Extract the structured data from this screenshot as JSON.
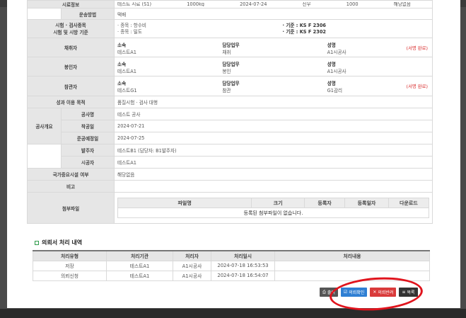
{
  "form": {
    "row_top": {
      "label": "시료정보",
      "value": "테스트 시료 (S1)",
      "qty": "1000kg",
      "date": "2024-07-24",
      "status": "진우",
      "num": "1000",
      "result": "해당없음"
    },
    "transport": {
      "label": "운송방법",
      "value": "택배"
    },
    "test": {
      "label": "시험 · 검사종목\n시험 및 시방 기준",
      "line1_type": "· 종목 : 항수비",
      "line1_std": "· 기준 : KS F 2306",
      "line2_type": "· 종목 : 밀도",
      "line2_std": "· 기준 : KS F 2302"
    },
    "sampler": {
      "label": "채취자",
      "org_k": "소속",
      "org": "테스트A1",
      "task_k": "담당업무",
      "task": "채취",
      "name_k": "성명",
      "name": "A1시공사",
      "sign": "(서명 완료)"
    },
    "sealer": {
      "label": "봉인자",
      "org_k": "소속",
      "org": "테스트A1",
      "task_k": "담당업무",
      "task": "봉인",
      "name_k": "성명",
      "name": "A1시공사",
      "sign": ""
    },
    "witness": {
      "label": "참관자",
      "org_k": "소속",
      "org": "테스트G1",
      "task_k": "담당업무",
      "task": "참관",
      "name_k": "성명",
      "name": "G1감리",
      "sign": "(서명 완료)"
    },
    "purpose": {
      "label": "성과 이용 목적",
      "value": "품질시험 · 검사 대행"
    },
    "overview_label": "공사개요",
    "project": {
      "label": "공사명",
      "value": "테스트 공사"
    },
    "start": {
      "label": "착공일",
      "value": "2024-07-21"
    },
    "finish": {
      "label": "준공예정일",
      "value": "2024-07-25"
    },
    "client": {
      "label": "발주자",
      "value": "테스트B1 (담당자: B1발주자)"
    },
    "builder": {
      "label": "시공자",
      "value": "테스트A1"
    },
    "national": {
      "label": "국가중요시설 여부",
      "value": "해당없음"
    },
    "remark": {
      "label": "비고",
      "value": ""
    },
    "attach": {
      "label": "첨부파일",
      "cols": [
        "파일명",
        "크기",
        "등록자",
        "등록일자",
        "다운로드"
      ],
      "empty": "등록된 첨부파일이 없습니다."
    }
  },
  "history": {
    "title": "의뢰서 처리 내역",
    "cols": [
      "처리유형",
      "처리기관",
      "처리자",
      "처리일시",
      "처리내용"
    ],
    "rows": [
      [
        "저장",
        "테스트A1",
        "A1시공사",
        "2024-07-18 16:53:53",
        ""
      ],
      [
        "의뢰신청",
        "테스트A1",
        "A1시공사",
        "2024-07-18 16:54:07",
        ""
      ]
    ]
  },
  "buttons": {
    "print": "출력",
    "confirm": "의뢰확인",
    "reject": "의뢰반려",
    "list": "목록"
  },
  "colors": {
    "confirm": "#2f7fd3",
    "reject": "#d93a3a",
    "highlight": "#e0141d"
  }
}
